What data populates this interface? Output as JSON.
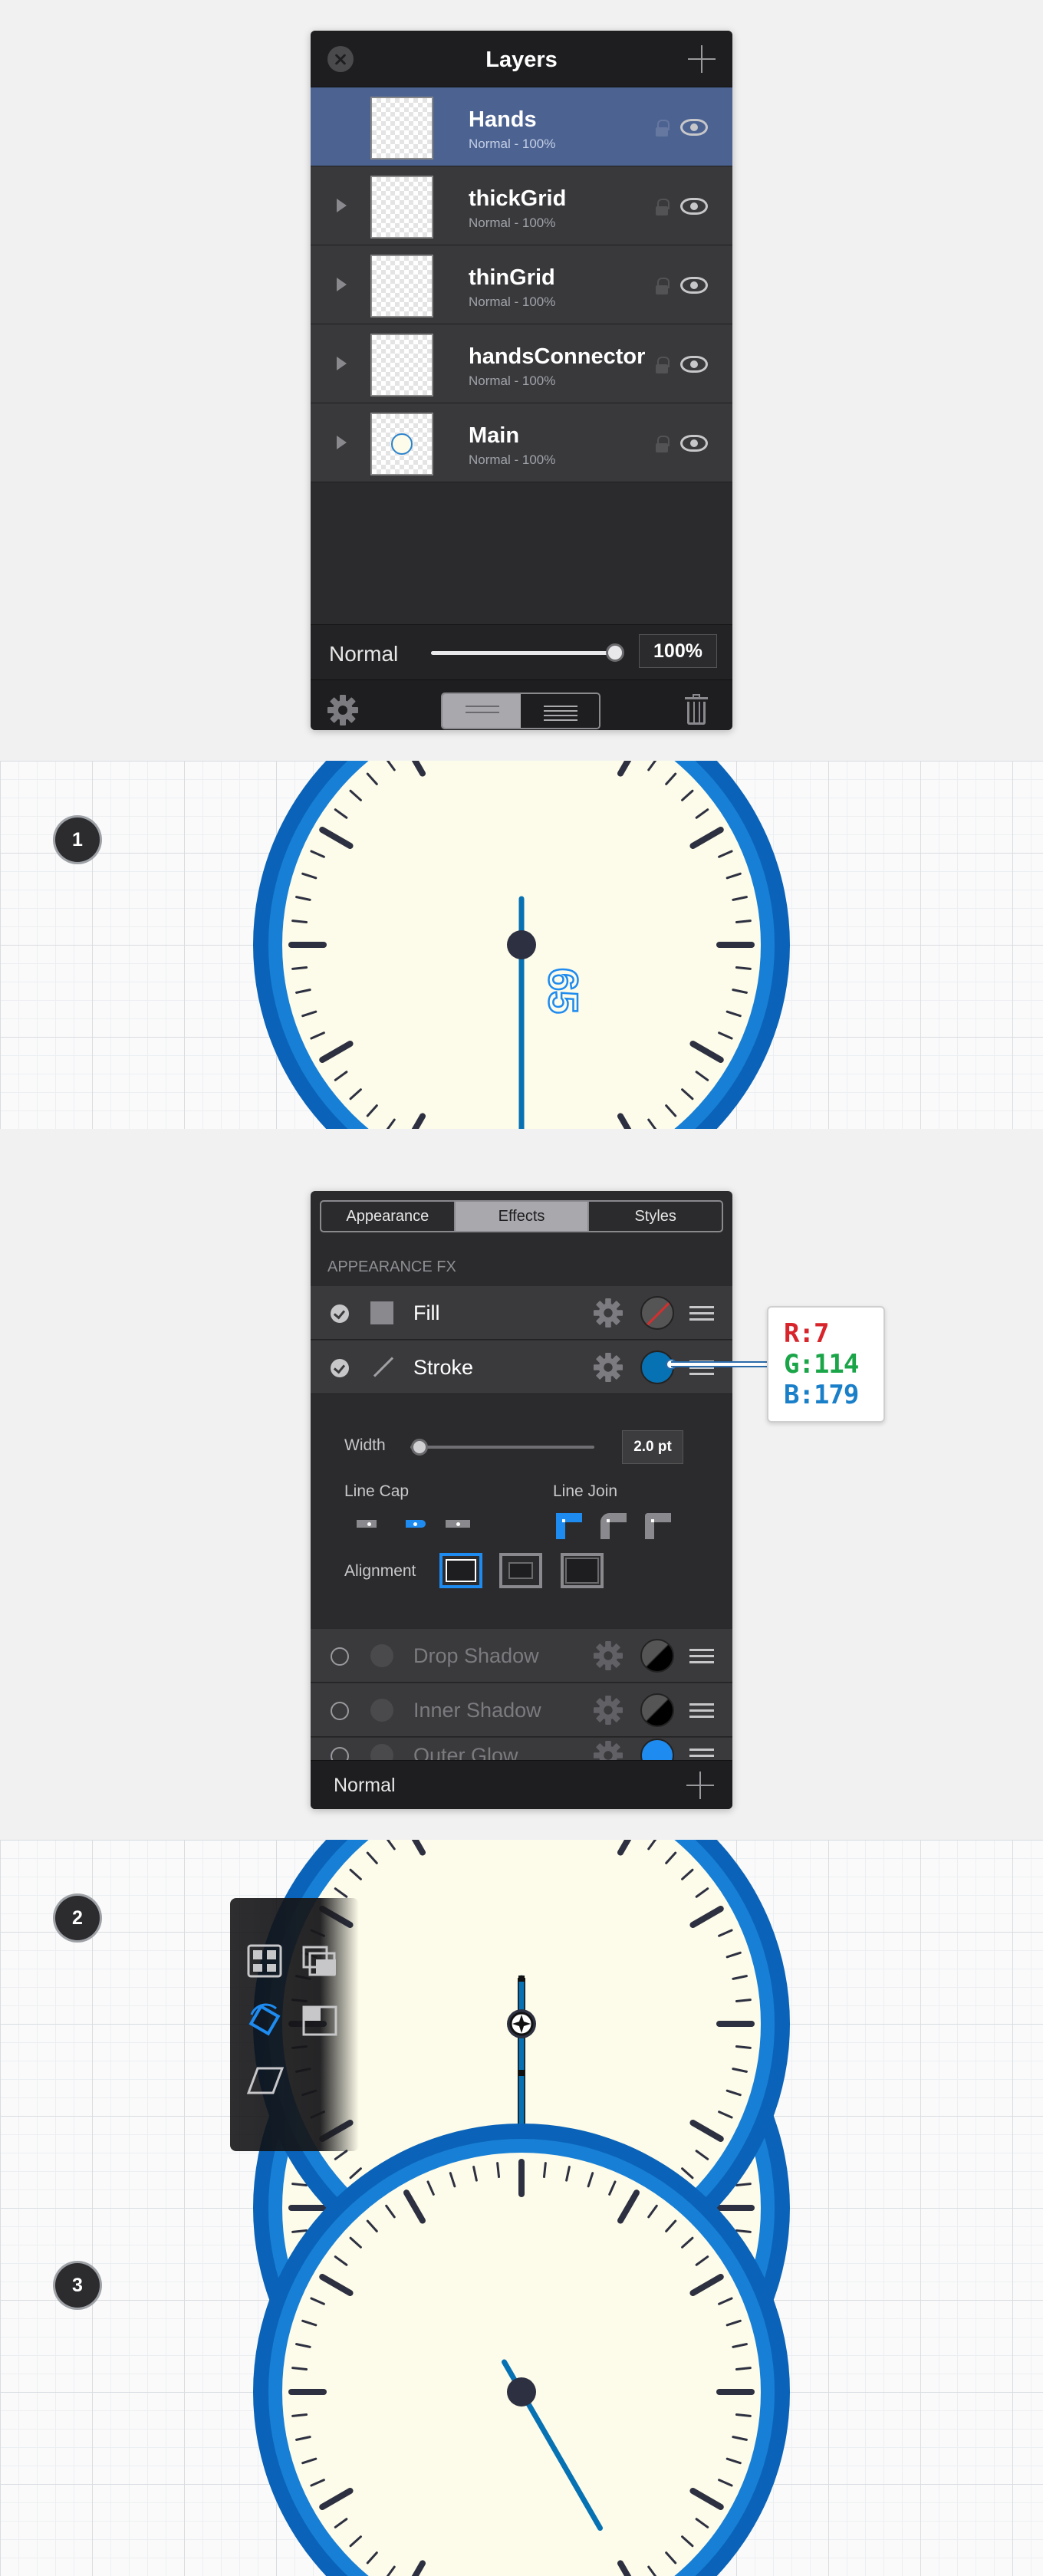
{
  "layers_panel": {
    "title": "Layers",
    "layers": [
      {
        "name": "Hands",
        "mode": "Normal - 100%",
        "selected": true,
        "has_children": false
      },
      {
        "name": "thickGrid",
        "mode": "Normal - 100%",
        "selected": false,
        "has_children": true
      },
      {
        "name": "thinGrid",
        "mode": "Normal - 100%",
        "selected": false,
        "has_children": true
      },
      {
        "name": "handsConnector",
        "mode": "Normal - 100%",
        "selected": false,
        "has_children": true
      },
      {
        "name": "Main",
        "mode": "Normal - 100%",
        "selected": false,
        "has_children": true
      }
    ],
    "blend_mode": "Normal",
    "opacity": "100%",
    "opacity_level": 1.0
  },
  "steps": [
    "1",
    "2",
    "3"
  ],
  "step1": {
    "annotation": "65"
  },
  "appearance_panel": {
    "tabs": [
      "Appearance",
      "Effects",
      "Styles"
    ],
    "active_tab": "Effects",
    "section_label": "APPEARANCE FX",
    "fill_label": "Fill",
    "stroke_label": "Stroke",
    "width_label": "Width",
    "width_value": "2.0 pt",
    "width_level": 0.05,
    "line_cap_label": "Line Cap",
    "line_join_label": "Line Join",
    "alignment_label": "Alignment",
    "effects": [
      {
        "label": "Drop Shadow",
        "swatch": "black"
      },
      {
        "label": "Inner Shadow",
        "swatch": "black"
      },
      {
        "label": "Outer Glow",
        "swatch": "blue"
      }
    ],
    "footer_label": "Normal"
  },
  "stroke_color": {
    "r_label": "R:7",
    "g_label": "G:114",
    "b_label": "B:179",
    "hex": "#0772b3"
  },
  "colors": {
    "accent_blue": "#1e8bf0",
    "clock_ring_outer": "#0a63b8",
    "clock_ring_inner": "#1780d6",
    "clock_face": "#fdfbe9",
    "hand": "#0772b3",
    "tick": "#2d3040",
    "panel_bg": "#2b2b2d",
    "selected_row": "#4c6392",
    "r_text": "#d8242b",
    "g_text": "#1aa548",
    "b_text": "#1a7fc9"
  },
  "icons": [
    "close-icon",
    "plus-icon",
    "lock-icon",
    "eye-icon",
    "gear-icon",
    "trash-icon",
    "checkmark-icon",
    "transform-tool-icons"
  ]
}
